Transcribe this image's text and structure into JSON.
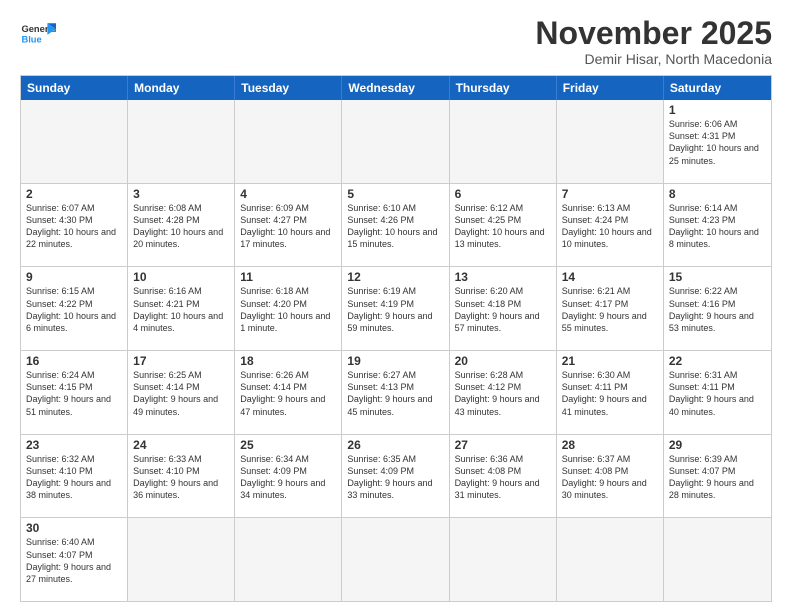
{
  "header": {
    "logo_general": "General",
    "logo_blue": "Blue",
    "month_title": "November 2025",
    "location": "Demir Hisar, North Macedonia"
  },
  "day_headers": [
    "Sunday",
    "Monday",
    "Tuesday",
    "Wednesday",
    "Thursday",
    "Friday",
    "Saturday"
  ],
  "weeks": [
    [
      {
        "num": "",
        "info": "",
        "empty": true
      },
      {
        "num": "",
        "info": "",
        "empty": true
      },
      {
        "num": "",
        "info": "",
        "empty": true
      },
      {
        "num": "",
        "info": "",
        "empty": true
      },
      {
        "num": "",
        "info": "",
        "empty": true
      },
      {
        "num": "",
        "info": "",
        "empty": true
      },
      {
        "num": "1",
        "info": "Sunrise: 6:06 AM\nSunset: 4:31 PM\nDaylight: 10 hours\nand 25 minutes.",
        "empty": false
      }
    ],
    [
      {
        "num": "2",
        "info": "Sunrise: 6:07 AM\nSunset: 4:30 PM\nDaylight: 10 hours\nand 22 minutes.",
        "empty": false
      },
      {
        "num": "3",
        "info": "Sunrise: 6:08 AM\nSunset: 4:28 PM\nDaylight: 10 hours\nand 20 minutes.",
        "empty": false
      },
      {
        "num": "4",
        "info": "Sunrise: 6:09 AM\nSunset: 4:27 PM\nDaylight: 10 hours\nand 17 minutes.",
        "empty": false
      },
      {
        "num": "5",
        "info": "Sunrise: 6:10 AM\nSunset: 4:26 PM\nDaylight: 10 hours\nand 15 minutes.",
        "empty": false
      },
      {
        "num": "6",
        "info": "Sunrise: 6:12 AM\nSunset: 4:25 PM\nDaylight: 10 hours\nand 13 minutes.",
        "empty": false
      },
      {
        "num": "7",
        "info": "Sunrise: 6:13 AM\nSunset: 4:24 PM\nDaylight: 10 hours\nand 10 minutes.",
        "empty": false
      },
      {
        "num": "8",
        "info": "Sunrise: 6:14 AM\nSunset: 4:23 PM\nDaylight: 10 hours\nand 8 minutes.",
        "empty": false
      }
    ],
    [
      {
        "num": "9",
        "info": "Sunrise: 6:15 AM\nSunset: 4:22 PM\nDaylight: 10 hours\nand 6 minutes.",
        "empty": false
      },
      {
        "num": "10",
        "info": "Sunrise: 6:16 AM\nSunset: 4:21 PM\nDaylight: 10 hours\nand 4 minutes.",
        "empty": false
      },
      {
        "num": "11",
        "info": "Sunrise: 6:18 AM\nSunset: 4:20 PM\nDaylight: 10 hours\nand 1 minute.",
        "empty": false
      },
      {
        "num": "12",
        "info": "Sunrise: 6:19 AM\nSunset: 4:19 PM\nDaylight: 9 hours\nand 59 minutes.",
        "empty": false
      },
      {
        "num": "13",
        "info": "Sunrise: 6:20 AM\nSunset: 4:18 PM\nDaylight: 9 hours\nand 57 minutes.",
        "empty": false
      },
      {
        "num": "14",
        "info": "Sunrise: 6:21 AM\nSunset: 4:17 PM\nDaylight: 9 hours\nand 55 minutes.",
        "empty": false
      },
      {
        "num": "15",
        "info": "Sunrise: 6:22 AM\nSunset: 4:16 PM\nDaylight: 9 hours\nand 53 minutes.",
        "empty": false
      }
    ],
    [
      {
        "num": "16",
        "info": "Sunrise: 6:24 AM\nSunset: 4:15 PM\nDaylight: 9 hours\nand 51 minutes.",
        "empty": false
      },
      {
        "num": "17",
        "info": "Sunrise: 6:25 AM\nSunset: 4:14 PM\nDaylight: 9 hours\nand 49 minutes.",
        "empty": false
      },
      {
        "num": "18",
        "info": "Sunrise: 6:26 AM\nSunset: 4:14 PM\nDaylight: 9 hours\nand 47 minutes.",
        "empty": false
      },
      {
        "num": "19",
        "info": "Sunrise: 6:27 AM\nSunset: 4:13 PM\nDaylight: 9 hours\nand 45 minutes.",
        "empty": false
      },
      {
        "num": "20",
        "info": "Sunrise: 6:28 AM\nSunset: 4:12 PM\nDaylight: 9 hours\nand 43 minutes.",
        "empty": false
      },
      {
        "num": "21",
        "info": "Sunrise: 6:30 AM\nSunset: 4:11 PM\nDaylight: 9 hours\nand 41 minutes.",
        "empty": false
      },
      {
        "num": "22",
        "info": "Sunrise: 6:31 AM\nSunset: 4:11 PM\nDaylight: 9 hours\nand 40 minutes.",
        "empty": false
      }
    ],
    [
      {
        "num": "23",
        "info": "Sunrise: 6:32 AM\nSunset: 4:10 PM\nDaylight: 9 hours\nand 38 minutes.",
        "empty": false
      },
      {
        "num": "24",
        "info": "Sunrise: 6:33 AM\nSunset: 4:10 PM\nDaylight: 9 hours\nand 36 minutes.",
        "empty": false
      },
      {
        "num": "25",
        "info": "Sunrise: 6:34 AM\nSunset: 4:09 PM\nDaylight: 9 hours\nand 34 minutes.",
        "empty": false
      },
      {
        "num": "26",
        "info": "Sunrise: 6:35 AM\nSunset: 4:09 PM\nDaylight: 9 hours\nand 33 minutes.",
        "empty": false
      },
      {
        "num": "27",
        "info": "Sunrise: 6:36 AM\nSunset: 4:08 PM\nDaylight: 9 hours\nand 31 minutes.",
        "empty": false
      },
      {
        "num": "28",
        "info": "Sunrise: 6:37 AM\nSunset: 4:08 PM\nDaylight: 9 hours\nand 30 minutes.",
        "empty": false
      },
      {
        "num": "29",
        "info": "Sunrise: 6:39 AM\nSunset: 4:07 PM\nDaylight: 9 hours\nand 28 minutes.",
        "empty": false
      }
    ],
    [
      {
        "num": "30",
        "info": "Sunrise: 6:40 AM\nSunset: 4:07 PM\nDaylight: 9 hours\nand 27 minutes.",
        "empty": false
      },
      {
        "num": "",
        "info": "",
        "empty": true
      },
      {
        "num": "",
        "info": "",
        "empty": true
      },
      {
        "num": "",
        "info": "",
        "empty": true
      },
      {
        "num": "",
        "info": "",
        "empty": true
      },
      {
        "num": "",
        "info": "",
        "empty": true
      },
      {
        "num": "",
        "info": "",
        "empty": true
      }
    ]
  ]
}
